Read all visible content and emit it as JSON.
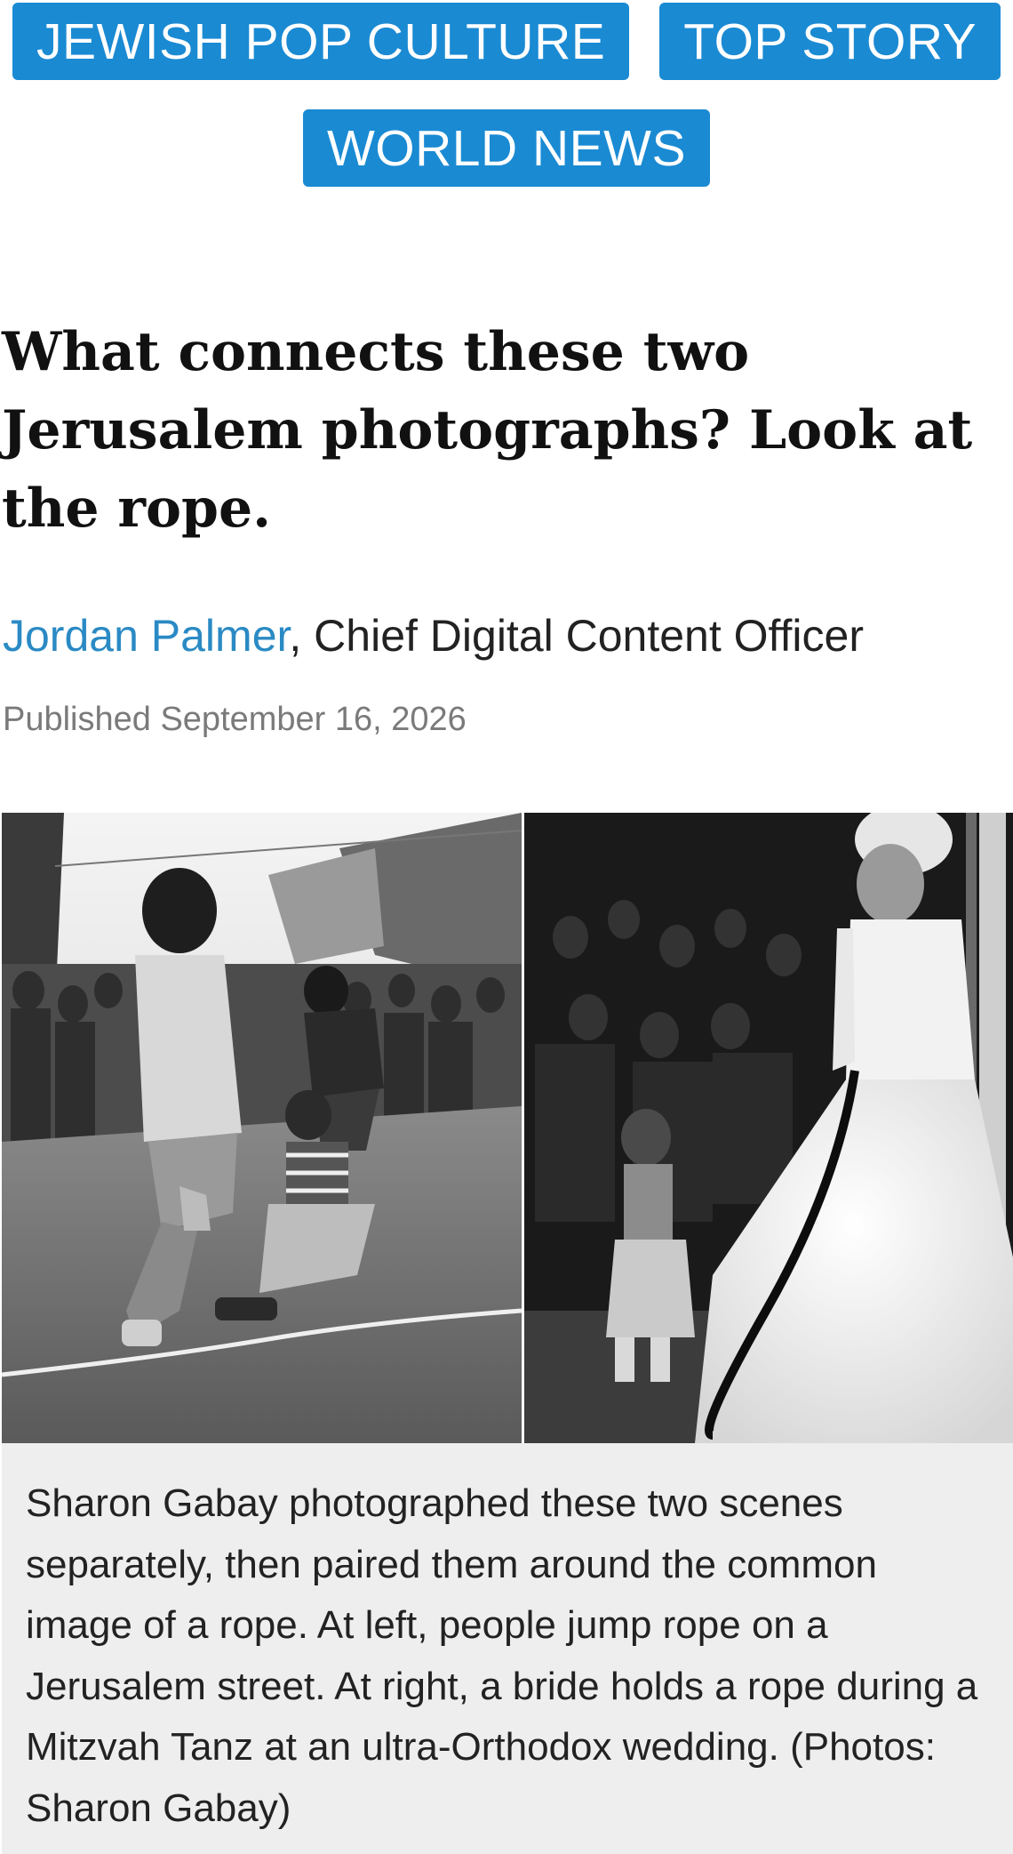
{
  "tags": [
    {
      "label": "JEWISH POP CULTURE"
    },
    {
      "label": "TOP STORY"
    },
    {
      "label": "WORLD NEWS"
    }
  ],
  "article": {
    "headline": "What connects these two Jerusalem photographs? Look at the rope.",
    "author": "Jordan Palmer",
    "author_role": ", Chief Digital Content Officer",
    "published": "Published September 16, 2026",
    "image": {
      "left_scene": "people jumping rope on a Jerusalem street, black and white",
      "right_scene": "bride in white gown holding a rope during a Mitzvah Tanz, black and white"
    },
    "caption": "Sharon Gabay photographed these two scenes separately, then paired them around the common image of a rope. At left, people jump rope on a Jerusalem street. At right, a bride holds a rope during a Mitzvah Tanz at an ultra-Orthodox wedding. (Photos: Sharon Gabay)"
  },
  "colors": {
    "tag_background": "#1a8ad3",
    "tag_text": "#ffffff",
    "author_link": "#2a8ac4",
    "published_text": "#7a7a7a",
    "caption_background": "#eeeeee"
  }
}
